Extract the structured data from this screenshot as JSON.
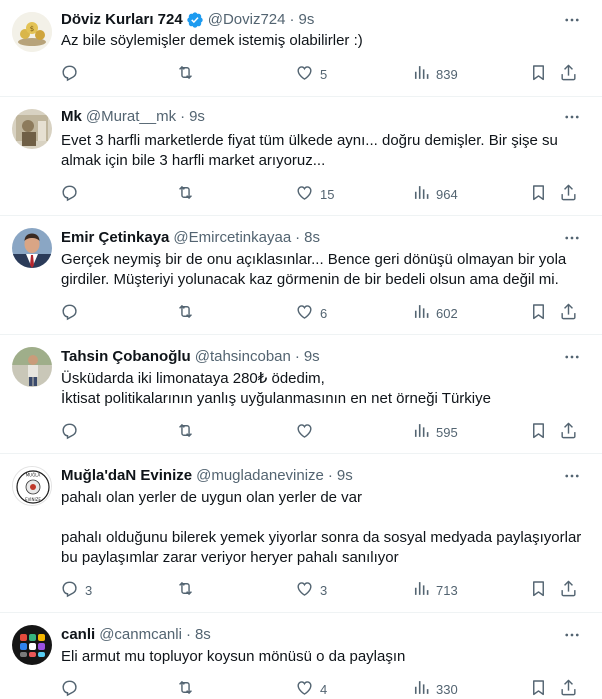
{
  "tweets": [
    {
      "name": "Döviz Kurları 724",
      "verified": true,
      "handle": "@Doviz724",
      "time": "9s",
      "text": "Az bile söylemişler demek istemiş olabilirler :)",
      "replies": "",
      "retweets": "",
      "likes": "5",
      "views": "839"
    },
    {
      "name": "Mk",
      "verified": false,
      "handle": "@Murat__mk",
      "time": "9s",
      "text": "Evet 3 harfli marketlerde fiyat tüm ülkede aynı... doğru demişler. Bir şişe su almak için bile 3 harfli market arıyoruz...",
      "replies": "",
      "retweets": "",
      "likes": "15",
      "views": "964"
    },
    {
      "name": "Emir Çetinkaya",
      "verified": false,
      "handle": "@Emircetinkayaa",
      "time": "8s",
      "text": "Gerçek neymiş bir de onu açıklasınlar... Bence geri dönüşü olmayan bir yola girdiler. Müşteriyi yolunacak kaz görmenin de bir bedeli olsun ama değil mi.",
      "replies": "",
      "retweets": "",
      "likes": "6",
      "views": "602"
    },
    {
      "name": "Tahsin Çobanoğlu",
      "verified": false,
      "handle": "@tahsincoban",
      "time": "9s",
      "text": "Üsküdarda iki limonataya 280₺ ödedim,\nİktisat politikalarının yanlış uyğulanmasının en net örneği Türkiye",
      "replies": "",
      "retweets": "",
      "likes": "",
      "views": "595"
    },
    {
      "name": "Muğla'daN Evinize",
      "verified": false,
      "handle": "@mugladanevinize",
      "time": "9s",
      "text": "pahalı olan yerler de uygun olan yerler de var\n\npahalı olduğunu bilerek yemek yiyorlar sonra da sosyal medyada paylaşıyorlar bu paylaşımlar zarar veriyor heryer pahalı sanılıyor",
      "replies": "3",
      "retweets": "",
      "likes": "3",
      "views": "713"
    },
    {
      "name": "canli",
      "verified": false,
      "handle": "@canmcanli",
      "time": "8s",
      "text": "Eli armut mu topluyor koysun mönüsü o da paylaşın",
      "replies": "",
      "retweets": "",
      "likes": "4",
      "views": "330"
    }
  ],
  "colors": {
    "text": "#0f1419",
    "secondary": "#536471",
    "verified": "#1d9bf0",
    "border": "#eff3f4"
  },
  "icons": {
    "verified": "verified-badge-icon",
    "more": "more-options-icon",
    "reply": "reply-icon",
    "retweet": "retweet-icon",
    "like": "heart-icon",
    "views": "views-chart-icon",
    "bookmark": "bookmark-icon",
    "share": "share-icon"
  }
}
